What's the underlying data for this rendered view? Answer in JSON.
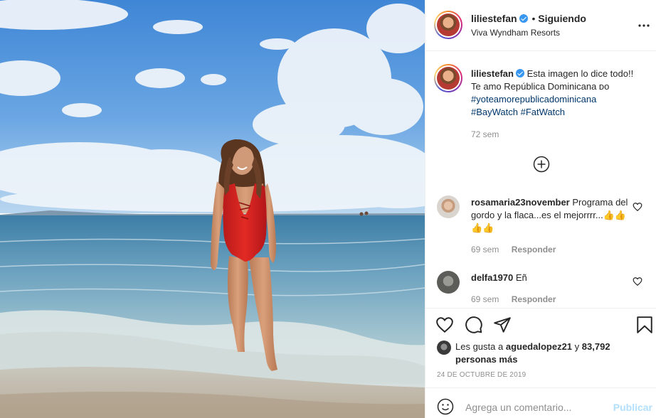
{
  "header": {
    "username": "liliestefan",
    "separator": "•",
    "follow_status": "Siguiendo",
    "location": "Viva Wyndham Resorts",
    "more_icon": "more-horizontal-icon"
  },
  "caption": {
    "username": "liliestefan",
    "text": "Esta imagen lo dice todo!! Te amo República Dominicana ᴅᴏ",
    "hashtag1": "#yoteamorepublicadominicana",
    "hashtag2": "#BayWatch",
    "hashtag3": "#FatWatch",
    "time": "72 sem"
  },
  "load_more_icon": "plus-circle-icon",
  "comments": [
    {
      "username": "rosamaria23november",
      "text": "Programa del gordo y la flaca...es el mejorrrr...",
      "emoji": "👍👍👍👍",
      "time": "69 sem",
      "reply": "Responder"
    },
    {
      "username": "delfa1970",
      "text": "Eñ",
      "time": "69 sem",
      "reply": "Responder"
    }
  ],
  "actions": {
    "like_icon": "heart-icon",
    "comment_icon": "comment-icon",
    "share_icon": "send-icon",
    "save_icon": "bookmark-icon"
  },
  "likes": {
    "prefix": "Les gusta a",
    "user": "aguedalopez21",
    "conj": "y",
    "count": "83,792 personas más"
  },
  "date": "24 DE OCTUBRE DE 2019",
  "add_comment": {
    "emoji_icon": "smiley-icon",
    "placeholder": "Agrega un comentario...",
    "publish": "Publicar"
  },
  "colors": {
    "link": "#00376b",
    "muted": "#8e8e8e",
    "verified": "#3897f0",
    "publish_disabled": "#b2dffc"
  }
}
